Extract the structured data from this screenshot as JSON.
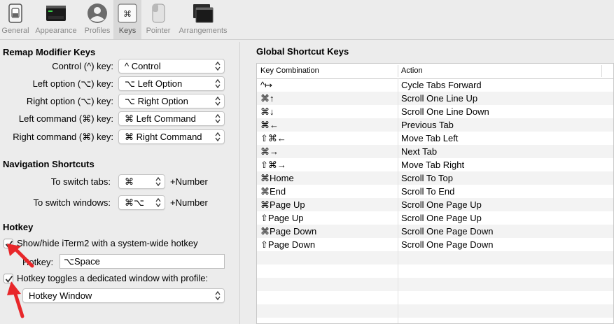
{
  "toolbar": {
    "items": [
      {
        "label": "General",
        "icon": "general-switch-icon",
        "active": false
      },
      {
        "label": "Appearance",
        "icon": "appearance-window-icon",
        "active": false
      },
      {
        "label": "Profiles",
        "icon": "profiles-person-icon",
        "active": false
      },
      {
        "label": "Keys",
        "icon": "keys-command-icon",
        "active": true
      },
      {
        "label": "Pointer",
        "icon": "pointer-mouse-icon",
        "active": false
      },
      {
        "label": "Arrangements",
        "icon": "arrangements-windows-icon",
        "active": false
      }
    ]
  },
  "remap": {
    "title": "Remap Modifier Keys",
    "rows": [
      {
        "label": "Control (^) key:",
        "value": "^ Control"
      },
      {
        "label": "Left option (⌥) key:",
        "value": "⌥ Left Option"
      },
      {
        "label": "Right option (⌥) key:",
        "value": "⌥ Right Option"
      },
      {
        "label": "Left command (⌘) key:",
        "value": "⌘ Left Command"
      },
      {
        "label": "Right command (⌘) key:",
        "value": "⌘ Right Command"
      }
    ]
  },
  "navigation": {
    "title": "Navigation Shortcuts",
    "tabs_label": "To switch tabs:",
    "tabs_value": "⌘",
    "tabs_suffix": "+Number",
    "windows_label": "To switch windows:",
    "windows_value": "⌘⌥",
    "windows_suffix": "+Number"
  },
  "hotkey": {
    "title": "Hotkey",
    "show_hide_label": "Show/hide iTerm2 with a system-wide hotkey",
    "show_hide_checked": true,
    "hotkey_label": "Hotkey:",
    "hotkey_value": "⌥Space",
    "dedicated_label": "Hotkey toggles a dedicated window with profile:",
    "dedicated_checked": true,
    "profile_value": "Hotkey Window"
  },
  "global": {
    "title": "Global Shortcut Keys",
    "col_key": "Key Combination",
    "col_action": "Action",
    "rows": [
      {
        "key": "^↦",
        "action": "Cycle Tabs Forward"
      },
      {
        "key": "⌘↑",
        "action": "Scroll One Line Up"
      },
      {
        "key": "⌘↓",
        "action": "Scroll One Line Down"
      },
      {
        "key": "⌘←",
        "action": "Previous Tab"
      },
      {
        "key": "⇧⌘←",
        "action": "Move Tab Left"
      },
      {
        "key": "⌘→",
        "action": "Next Tab"
      },
      {
        "key": "⇧⌘→",
        "action": "Move Tab Right"
      },
      {
        "key": "⌘Home",
        "action": "Scroll To Top"
      },
      {
        "key": "⌘End",
        "action": "Scroll To End"
      },
      {
        "key": "⌘Page Up",
        "action": "Scroll One Page Up"
      },
      {
        "key": "⇧Page Up",
        "action": "Scroll One Page Up"
      },
      {
        "key": "⌘Page Down",
        "action": "Scroll One Page Down"
      },
      {
        "key": "⇧Page Down",
        "action": "Scroll One Page Down"
      }
    ]
  },
  "colors": {
    "annotation_red": "#e8272a",
    "checkbox_mark": "#333333"
  }
}
